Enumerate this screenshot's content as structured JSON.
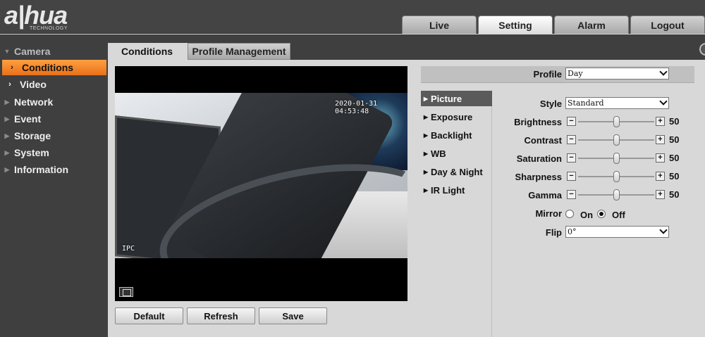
{
  "brand": {
    "logo": "a|hua",
    "tagline": "TECHNOLOGY"
  },
  "topnav": [
    {
      "label": "Live"
    },
    {
      "label": "Setting",
      "active": true
    },
    {
      "label": "Alarm"
    },
    {
      "label": "Logout"
    }
  ],
  "sidebar": {
    "items": [
      {
        "label": "Camera"
      },
      {
        "label": "Conditions"
      },
      {
        "label": "Video"
      },
      {
        "label": "Network"
      },
      {
        "label": "Event"
      },
      {
        "label": "Storage"
      },
      {
        "label": "System"
      },
      {
        "label": "Information"
      }
    ]
  },
  "tabs": {
    "conditions": "Conditions",
    "profile": "Profile Management"
  },
  "video": {
    "timestamp": "2020-01-31 04:53:48",
    "channel": "IPC"
  },
  "buttons": {
    "default": "Default",
    "refresh": "Refresh",
    "save": "Save"
  },
  "profile": {
    "label": "Profile",
    "value": "Day"
  },
  "subnav": [
    {
      "label": "Picture"
    },
    {
      "label": "Exposure"
    },
    {
      "label": "Backlight"
    },
    {
      "label": "WB"
    },
    {
      "label": "Day & Night"
    },
    {
      "label": "IR Light"
    }
  ],
  "picture": {
    "style": {
      "label": "Style",
      "value": "Standard"
    },
    "sliders": [
      {
        "label": "Brightness",
        "value": 50
      },
      {
        "label": "Contrast",
        "value": 50
      },
      {
        "label": "Saturation",
        "value": 50
      },
      {
        "label": "Sharpness",
        "value": 50
      },
      {
        "label": "Gamma",
        "value": 50
      }
    ],
    "mirror": {
      "label": "Mirror",
      "on": "On",
      "off": "Off",
      "selected": "Off"
    },
    "flip": {
      "label": "Flip",
      "value": "0°"
    }
  },
  "colors": {
    "accent": "#f08a2a",
    "header": "#444444",
    "sidebar": "#3f3f3f"
  }
}
